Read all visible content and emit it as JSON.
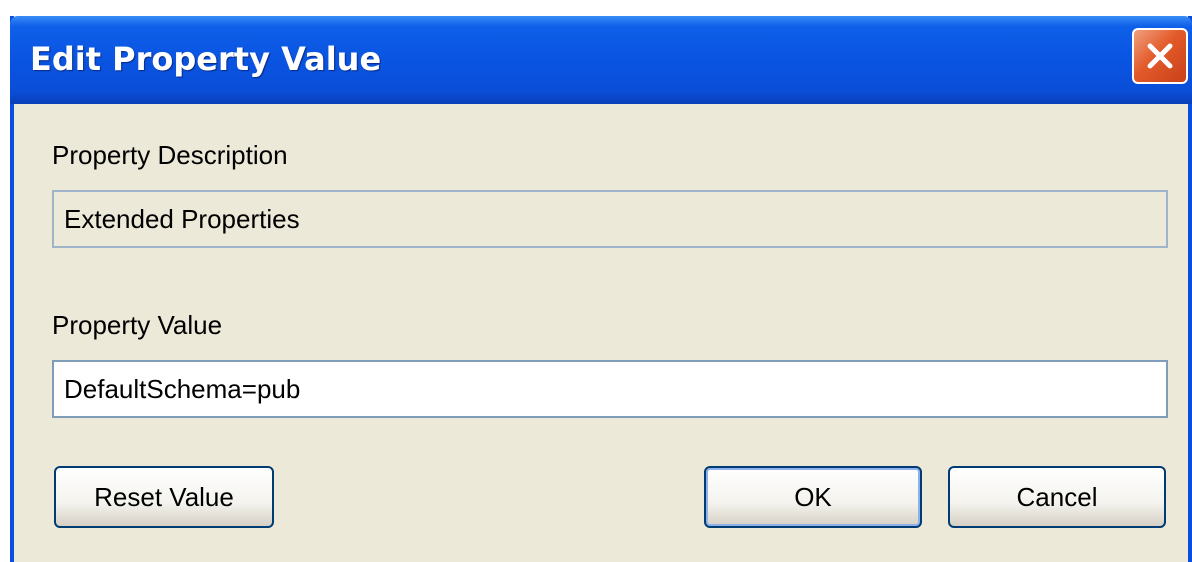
{
  "window": {
    "title": "Edit Property Value"
  },
  "property_description": {
    "label": "Property Description",
    "value": "Extended Properties"
  },
  "property_value": {
    "label": "Property Value",
    "value": "DefaultSchema=pub"
  },
  "buttons": {
    "reset": "Reset Value",
    "ok": "OK",
    "cancel": "Cancel"
  },
  "icons": {
    "close": "close-icon"
  },
  "colors": {
    "titlebar": "#0a54e2",
    "close_button": "#e35a2a",
    "dialog_background": "#ece9d8"
  }
}
